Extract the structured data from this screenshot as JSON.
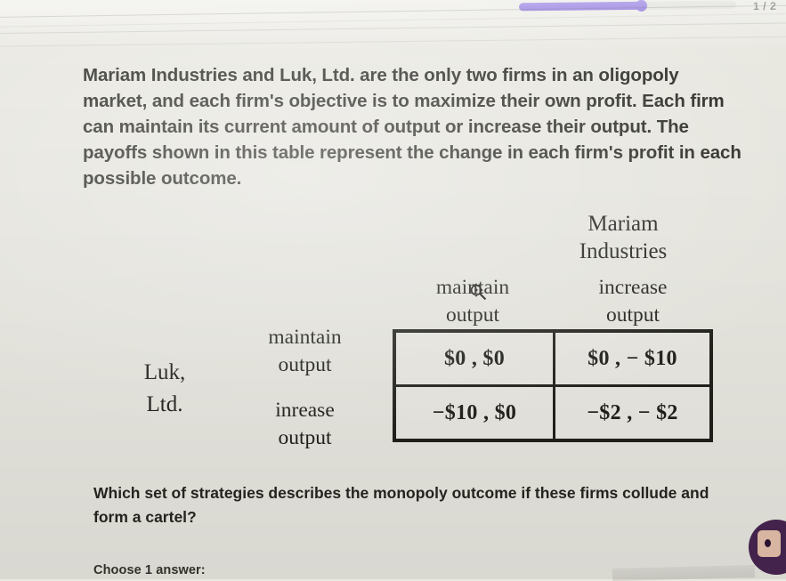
{
  "header": {
    "progress_count": "1 / 2",
    "progress_percent": 56,
    "accent_color": "#5b34d6",
    "track_color": "#d8d7d1"
  },
  "question": {
    "stem": "Mariam Industries and Luk, Ltd. are the only two firms in an oligopoly market, and each firm's objective is to maximize their own profit. Each firm can maintain its current amount of output or increase their output. The payoffs shown in this table represent the change in each firm's profit in each possible outcome.",
    "prompt": "Which set of strategies describes the monopoly outcome if these firms collude and form a cartel?",
    "choose_label": "Choose 1 answer:"
  },
  "payoff_matrix": {
    "column_player": {
      "line1": "Mariam",
      "line2": "Industries"
    },
    "row_player": {
      "line1": "Luk,",
      "line2": "Ltd."
    },
    "column_headers": [
      {
        "line1": "maintain",
        "line2": "output"
      },
      {
        "line1": "increase",
        "line2": "output"
      }
    ],
    "row_headers": [
      {
        "line1": "maintain",
        "line2": "output"
      },
      {
        "line1": "inrease",
        "line2": "output"
      }
    ],
    "cells": [
      [
        "$0 , $0",
        "$0 , − $10"
      ],
      [
        "−$10 , $0",
        "−$2 , − $2"
      ]
    ],
    "border_color": "#20201c",
    "cell_background": "#eceae4"
  },
  "page": {
    "background_color": "#e9e8e1",
    "text_color": "#26261f"
  },
  "avatar": {
    "background_color": "#43234b"
  }
}
